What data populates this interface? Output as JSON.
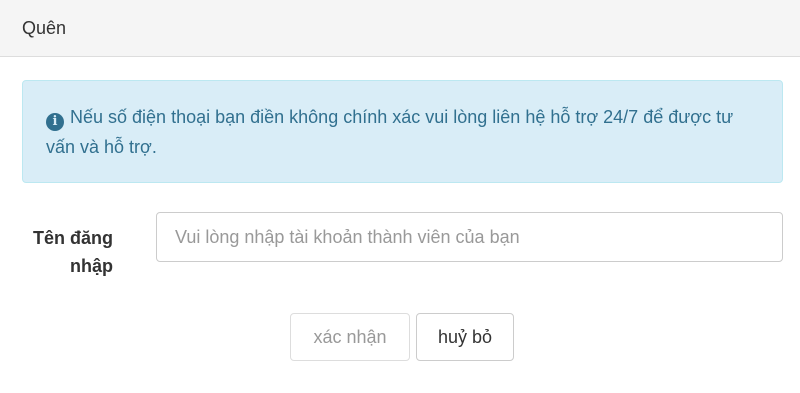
{
  "panel": {
    "title": "Quên"
  },
  "alert": {
    "icon": "info-circle-icon",
    "text": "Nếu số điện thoại bạn điền không chính xác vui lòng liên hệ hỗ trợ 24/7 để được tư vấn và hỗ trợ."
  },
  "form": {
    "username_label": "Tên đăng nhập",
    "username_value": "",
    "username_placeholder": "Vui lòng nhập tài khoản thành viên của bạn"
  },
  "buttons": {
    "confirm_label": "xác nhận",
    "confirm_disabled": true,
    "cancel_label": "huỷ bỏ"
  },
  "colors": {
    "alert_bg": "#d9edf7",
    "alert_text": "#31708f",
    "header_bg": "#f5f5f5"
  }
}
